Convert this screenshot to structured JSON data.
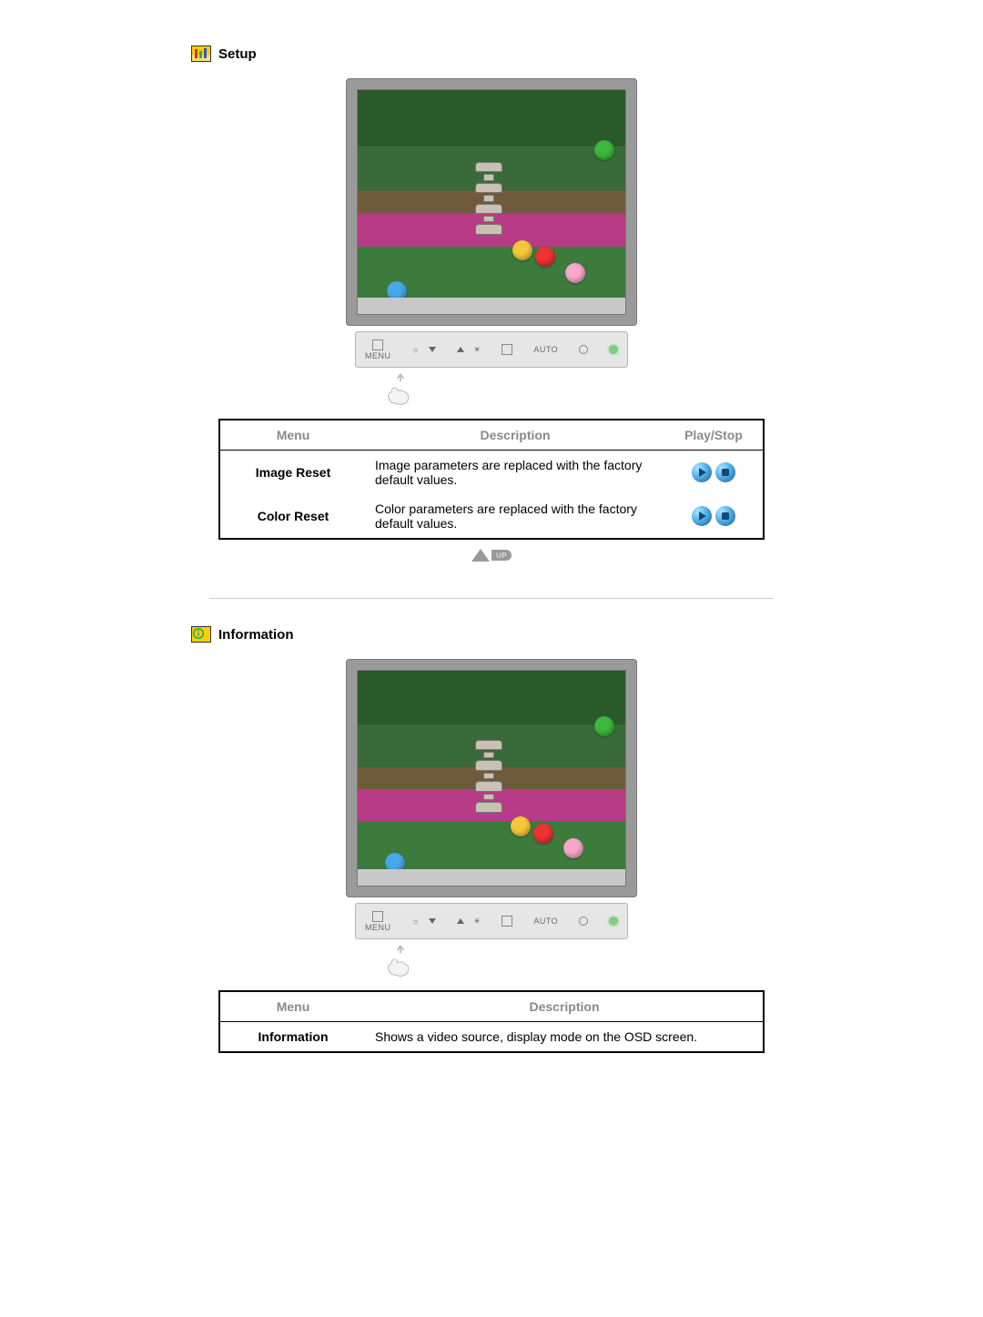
{
  "sections": {
    "setup": {
      "title": "Setup",
      "table": {
        "headers": {
          "menu": "Menu",
          "description": "Description",
          "playstop": "Play/Stop"
        },
        "rows": [
          {
            "menu": "Image Reset",
            "description": "Image parameters are replaced with the factory default values."
          },
          {
            "menu": "Color Reset",
            "description": "Color parameters are replaced with the factory default values."
          }
        ]
      }
    },
    "information": {
      "title": "Information",
      "table": {
        "headers": {
          "menu": "Menu",
          "description": "Description"
        },
        "rows": [
          {
            "menu": "Information",
            "description": "Shows a video source, display mode on the OSD screen."
          }
        ]
      }
    }
  },
  "monitor_controls": {
    "menu_label": "MENU",
    "auto_label": "AUTO"
  },
  "up_label": "UP"
}
